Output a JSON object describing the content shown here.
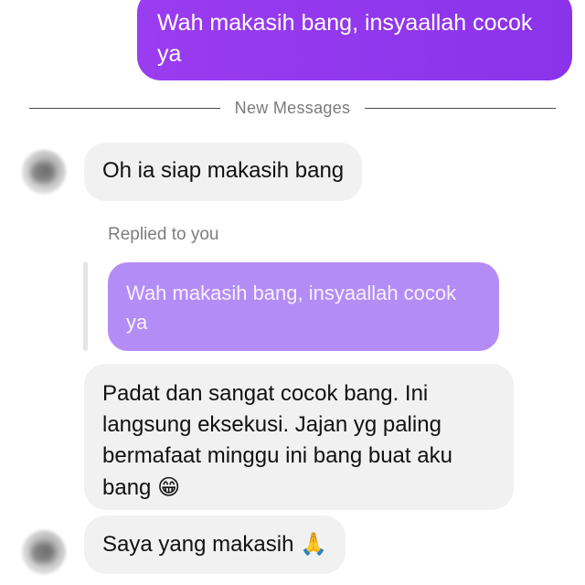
{
  "messages": {
    "outgoing_1": "Wah makasih bang, insyaallah cocok ya",
    "divider_label": "New Messages",
    "incoming_1": "Oh ia siap makasih bang",
    "reply_label": "Replied to you",
    "quoted_text": "Wah makasih bang, insyaallah cocok ya",
    "incoming_2_text": "Padat dan sangat cocok bang. Ini langsung eksekusi. Jajan yg paling bermafaat minggu ini bang buat aku bang",
    "incoming_2_emoji": "😁",
    "incoming_3_text": "Saya yang makasih",
    "incoming_3_emoji": "🙏"
  },
  "colors": {
    "outgoing_bubble": "#9a3cf0",
    "incoming_bubble": "#f1f1f2",
    "quoted_bubble": "#b48cf6",
    "meta_text": "#7d7d7d"
  },
  "icons": {
    "avatar": "contact-avatar-blurred"
  }
}
